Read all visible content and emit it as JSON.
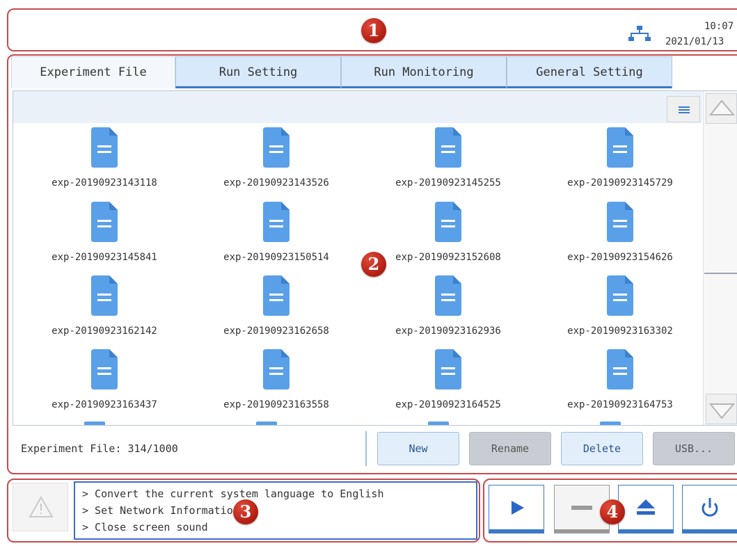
{
  "status_bar": {
    "time": "10:07",
    "date": "2021/01/13",
    "network_icon": "network-icon"
  },
  "badges": [
    "1",
    "2",
    "3",
    "4"
  ],
  "tabs": [
    {
      "label": "Experiment File",
      "active": true
    },
    {
      "label": "Run Setting",
      "active": false
    },
    {
      "label": "Run Monitoring",
      "active": false
    },
    {
      "label": "General Setting",
      "active": false
    }
  ],
  "files": [
    "exp-20190923143118",
    "exp-20190923143526",
    "exp-20190923145255",
    "exp-20190923145729",
    "exp-20190923145841",
    "exp-20190923150514",
    "exp-20190923152608",
    "exp-20190923154626",
    "exp-20190923162142",
    "exp-20190923162658",
    "exp-20190923162936",
    "exp-20190923163302",
    "exp-20190923163437",
    "exp-20190923163558",
    "exp-20190923164525",
    "exp-20190923164753"
  ],
  "footer": {
    "count_label": "Experiment File: 314/1000",
    "new_label": "New",
    "rename_label": "Rename",
    "delete_label": "Delete",
    "usb_label": "USB..."
  },
  "messages": [
    "> Convert the current system language to English",
    "> Set Network Information",
    "> Close screen sound"
  ],
  "colors": {
    "frame": "#c94a4a",
    "accent": "#3a78c9",
    "file_icon": "#5aa0e8"
  }
}
